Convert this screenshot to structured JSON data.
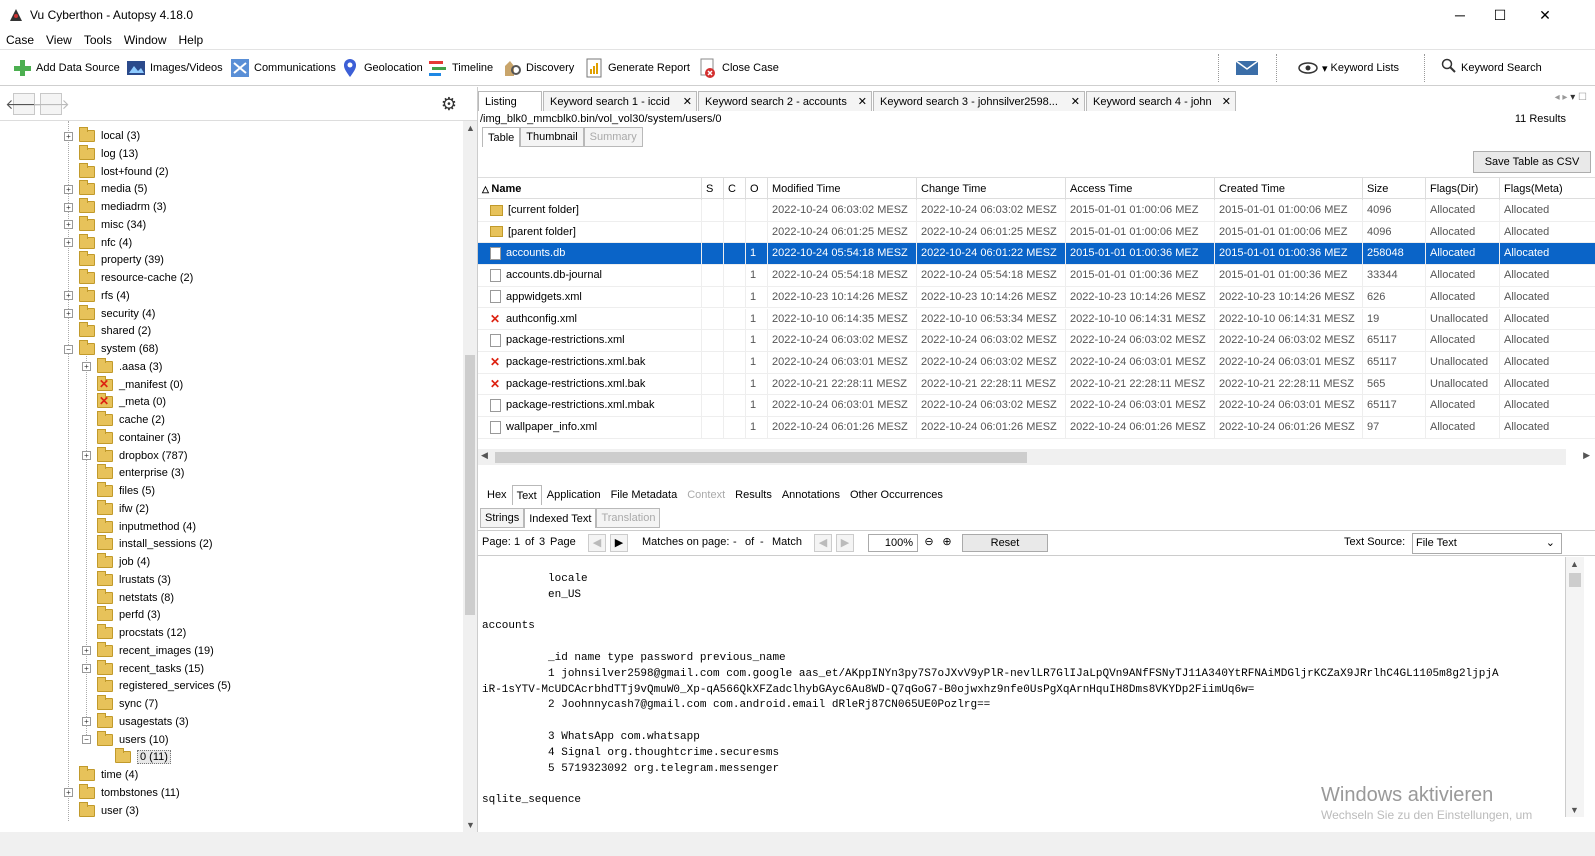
{
  "window": {
    "title": "Vu Cyberthon - Autopsy 4.18.0",
    "minimize": "─",
    "maximize": "☐",
    "close": "✕"
  },
  "menu": [
    "Case",
    "View",
    "Tools",
    "Window",
    "Help"
  ],
  "toolbar": {
    "add_data_source": "Add Data Source",
    "images_videos": "Images/Videos",
    "communications": "Communications",
    "geolocation": "Geolocation",
    "timeline": "Timeline",
    "discovery": "Discovery",
    "generate_report": "Generate Report",
    "close_case": "Close Case",
    "keyword_lists": "Keyword Lists",
    "keyword_search": "Keyword Search"
  },
  "tree": [
    {
      "label": "local (3)",
      "level": 1,
      "exp": "+"
    },
    {
      "label": "log (13)",
      "level": 1,
      "exp": ""
    },
    {
      "label": "lost+found (2)",
      "level": 1,
      "exp": ""
    },
    {
      "label": "media (5)",
      "level": 1,
      "exp": "+"
    },
    {
      "label": "mediadrm (3)",
      "level": 1,
      "exp": "+"
    },
    {
      "label": "misc (34)",
      "level": 1,
      "exp": "+"
    },
    {
      "label": "nfc (4)",
      "level": 1,
      "exp": "+"
    },
    {
      "label": "property (39)",
      "level": 1,
      "exp": ""
    },
    {
      "label": "resource-cache (2)",
      "level": 1,
      "exp": ""
    },
    {
      "label": "rfs (4)",
      "level": 1,
      "exp": "+"
    },
    {
      "label": "security (4)",
      "level": 1,
      "exp": "+"
    },
    {
      "label": "shared (2)",
      "level": 1,
      "exp": ""
    },
    {
      "label": "system (68)",
      "level": 1,
      "exp": "-"
    },
    {
      "label": ".aasa (3)",
      "level": 2,
      "exp": "+"
    },
    {
      "label": "_manifest (0)",
      "level": 2,
      "exp": "",
      "bad": true
    },
    {
      "label": "_meta (0)",
      "level": 2,
      "exp": "",
      "bad": true
    },
    {
      "label": "cache (2)",
      "level": 2,
      "exp": ""
    },
    {
      "label": "container (3)",
      "level": 2,
      "exp": ""
    },
    {
      "label": "dropbox (787)",
      "level": 2,
      "exp": "+"
    },
    {
      "label": "enterprise (3)",
      "level": 2,
      "exp": ""
    },
    {
      "label": "files (5)",
      "level": 2,
      "exp": ""
    },
    {
      "label": "ifw (2)",
      "level": 2,
      "exp": ""
    },
    {
      "label": "inputmethod (4)",
      "level": 2,
      "exp": ""
    },
    {
      "label": "install_sessions (2)",
      "level": 2,
      "exp": ""
    },
    {
      "label": "job (4)",
      "level": 2,
      "exp": ""
    },
    {
      "label": "lrustats (3)",
      "level": 2,
      "exp": ""
    },
    {
      "label": "netstats (8)",
      "level": 2,
      "exp": ""
    },
    {
      "label": "perfd (3)",
      "level": 2,
      "exp": ""
    },
    {
      "label": "procstats (12)",
      "level": 2,
      "exp": ""
    },
    {
      "label": "recent_images (19)",
      "level": 2,
      "exp": "+"
    },
    {
      "label": "recent_tasks (15)",
      "level": 2,
      "exp": "+"
    },
    {
      "label": "registered_services (5)",
      "level": 2,
      "exp": ""
    },
    {
      "label": "sync (7)",
      "level": 2,
      "exp": ""
    },
    {
      "label": "usagestats (3)",
      "level": 2,
      "exp": "+"
    },
    {
      "label": "users (10)",
      "level": 2,
      "exp": "-"
    },
    {
      "label": "0 (11)",
      "level": 3,
      "exp": "",
      "selected": true
    },
    {
      "label": "time (4)",
      "level": 1,
      "exp": ""
    },
    {
      "label": "tombstones (11)",
      "level": 1,
      "exp": "+"
    },
    {
      "label": "user (3)",
      "level": 1,
      "exp": ""
    }
  ],
  "tabs": [
    {
      "label": "Listing",
      "closable": false
    },
    {
      "label": "Keyword search 1 - iccid",
      "closable": true
    },
    {
      "label": "Keyword search 2 - accounts",
      "closable": true
    },
    {
      "label": "Keyword search 3 - johnsilver2598...",
      "closable": true
    },
    {
      "label": "Keyword search 4 - john",
      "closable": true
    }
  ],
  "path": "/img_blk0_mmcblk0.bin/vol_vol30/system/users/0",
  "results": "11  Results",
  "view_tabs": [
    "Table",
    "Thumbnail",
    "Summary"
  ],
  "save_csv": "Save Table as CSV",
  "columns": [
    "Name",
    "S",
    "C",
    "O",
    "Modified Time",
    "Change Time",
    "Access Time",
    "Created Time",
    "Size",
    "Flags(Dir)",
    "Flags(Meta)"
  ],
  "rows": [
    {
      "icon": "fold",
      "name": "[current folder]",
      "o": "",
      "mod": "2022-10-24 06:03:02 MESZ",
      "chg": "2022-10-24 06:03:02 MESZ",
      "acc": "2015-01-01 01:00:06 MEZ",
      "cre": "2015-01-01 01:00:06 MEZ",
      "size": "4096",
      "fdir": "Allocated",
      "fmeta": "Allocated"
    },
    {
      "icon": "fold",
      "name": "[parent folder]",
      "o": "",
      "mod": "2022-10-24 06:01:25 MESZ",
      "chg": "2022-10-24 06:01:25 MESZ",
      "acc": "2015-01-01 01:00:06 MEZ",
      "cre": "2015-01-01 01:00:06 MEZ",
      "size": "4096",
      "fdir": "Allocated",
      "fmeta": "Allocated"
    },
    {
      "icon": "doc",
      "name": "accounts.db",
      "o": "1",
      "mod": "2022-10-24 05:54:18 MESZ",
      "chg": "2022-10-24 06:01:22 MESZ",
      "acc": "2015-01-01 01:00:36 MEZ",
      "cre": "2015-01-01 01:00:36 MEZ",
      "size": "258048",
      "fdir": "Allocated",
      "fmeta": "Allocated",
      "selected": true
    },
    {
      "icon": "doc",
      "name": "accounts.db-journal",
      "o": "1",
      "mod": "2022-10-24 05:54:18 MESZ",
      "chg": "2022-10-24 05:54:18 MESZ",
      "acc": "2015-01-01 01:00:36 MEZ",
      "cre": "2015-01-01 01:00:36 MEZ",
      "size": "33344",
      "fdir": "Allocated",
      "fmeta": "Allocated"
    },
    {
      "icon": "doc",
      "name": "appwidgets.xml",
      "o": "1",
      "mod": "2022-10-23 10:14:26 MESZ",
      "chg": "2022-10-23 10:14:26 MESZ",
      "acc": "2022-10-23 10:14:26 MESZ",
      "cre": "2022-10-23 10:14:26 MESZ",
      "size": "626",
      "fdir": "Allocated",
      "fmeta": "Allocated"
    },
    {
      "icon": "del",
      "name": "authconfig.xml",
      "o": "1",
      "mod": "2022-10-10 06:14:35 MESZ",
      "chg": "2022-10-10 06:53:34 MESZ",
      "acc": "2022-10-10 06:14:31 MESZ",
      "cre": "2022-10-10 06:14:31 MESZ",
      "size": "19",
      "fdir": "Unallocated",
      "fmeta": "Allocated"
    },
    {
      "icon": "doc",
      "name": "package-restrictions.xml",
      "o": "1",
      "mod": "2022-10-24 06:03:02 MESZ",
      "chg": "2022-10-24 06:03:02 MESZ",
      "acc": "2022-10-24 06:03:02 MESZ",
      "cre": "2022-10-24 06:03:02 MESZ",
      "size": "65117",
      "fdir": "Allocated",
      "fmeta": "Allocated"
    },
    {
      "icon": "del",
      "name": "package-restrictions.xml.bak",
      "o": "1",
      "mod": "2022-10-24 06:03:01 MESZ",
      "chg": "2022-10-24 06:03:02 MESZ",
      "acc": "2022-10-24 06:03:01 MESZ",
      "cre": "2022-10-24 06:03:01 MESZ",
      "size": "65117",
      "fdir": "Unallocated",
      "fmeta": "Allocated"
    },
    {
      "icon": "del",
      "name": "package-restrictions.xml.bak",
      "o": "1",
      "mod": "2022-10-21 22:28:11 MESZ",
      "chg": "2022-10-21 22:28:11 MESZ",
      "acc": "2022-10-21 22:28:11 MESZ",
      "cre": "2022-10-21 22:28:11 MESZ",
      "size": "565",
      "fdir": "Unallocated",
      "fmeta": "Allocated"
    },
    {
      "icon": "doc",
      "name": "package-restrictions.xml.mbak",
      "o": "1",
      "mod": "2022-10-24 06:03:01 MESZ",
      "chg": "2022-10-24 06:03:02 MESZ",
      "acc": "2022-10-24 06:03:01 MESZ",
      "cre": "2022-10-24 06:03:01 MESZ",
      "size": "65117",
      "fdir": "Allocated",
      "fmeta": "Allocated"
    },
    {
      "icon": "doc",
      "name": "wallpaper_info.xml",
      "o": "1",
      "mod": "2022-10-24 06:01:26 MESZ",
      "chg": "2022-10-24 06:01:26 MESZ",
      "acc": "2022-10-24 06:01:26 MESZ",
      "cre": "2022-10-24 06:01:26 MESZ",
      "size": "97",
      "fdir": "Allocated",
      "fmeta": "Allocated"
    }
  ],
  "content_tabs": [
    "Hex",
    "Text",
    "Application",
    "File Metadata",
    "Context",
    "Results",
    "Annotations",
    "Other Occurrences"
  ],
  "text_tabs": [
    "Strings",
    "Indexed Text",
    "Translation"
  ],
  "pager": {
    "page_label": "Page:",
    "page": "1",
    "of": "of",
    "pages": "3",
    "page_word": "Page",
    "matches_label": "Matches on page:",
    "m_cur": "-",
    "m_of": "of",
    "m_tot": "-",
    "match_word": "Match",
    "zoom": "100%",
    "reset": "Reset",
    "source_label": "Text Source:",
    "source": "File Text"
  },
  "text_lines": [
    "          locale",
    "          en_US",
    "",
    "accounts",
    "",
    "          _id name type password previous_name",
    "          1 johnsilver2598@gmail.com com.google aas_et/AKppINYn3py7S7oJXvV9yPlR-nevlLR7GlIJaLpQVn9ANfFSNyTJ11A340YtRFNAiMDGljrKCZaX9JRrlhC4GL1105m8g2ljpjA",
    "iR-1sYTV-McUDCAcrbhdTTj9vQmuW0_Xp-qA566QkXFZadclhybGAyc6Au8WD-Q7qGoG7-B0ojwxhz9nfe0UsPgXqArnHquIH8Dms8VKYDp2FiimUq6w=",
    "          2 Joohnnycash7@gmail.com com.android.email dRleRj87CN065UE0Pozlrg==",
    "",
    "          3 WhatsApp com.whatsapp",
    "          4 Signal org.thoughtcrime.securesms",
    "          5 5719323092 org.telegram.messenger",
    "",
    "sqlite_sequence"
  ],
  "watermark": {
    "line1": "Windows aktivieren",
    "line2": "Wechseln Sie zu den Einstellungen, um"
  }
}
